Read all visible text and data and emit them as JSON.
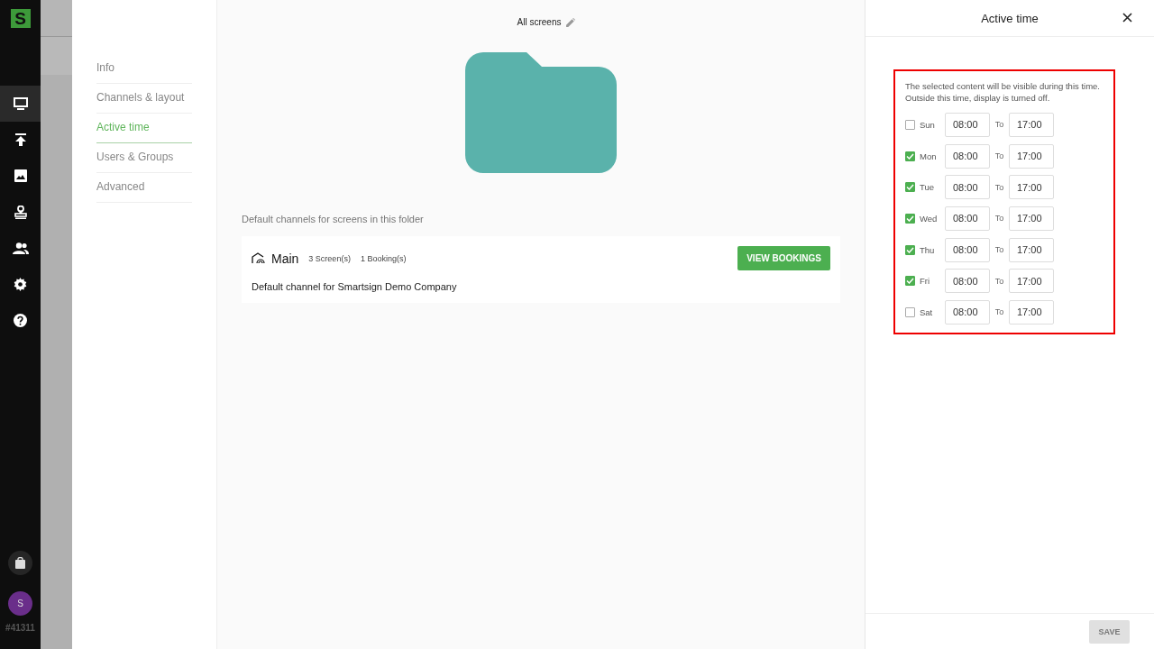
{
  "rail": {
    "logo": "S",
    "items": [
      {
        "kind": "monitor",
        "selected": true
      },
      {
        "kind": "upload",
        "selected": false
      },
      {
        "kind": "image",
        "selected": false
      },
      {
        "kind": "stamp",
        "selected": false
      },
      {
        "kind": "users",
        "selected": false
      },
      {
        "kind": "settings",
        "selected": false
      },
      {
        "kind": "help",
        "selected": false
      }
    ],
    "avatar": "S",
    "account_id": "#41311"
  },
  "nav": {
    "items": [
      {
        "label": "Info",
        "selected": false
      },
      {
        "label": "Channels & layout",
        "selected": false
      },
      {
        "label": "Active time",
        "selected": true
      },
      {
        "label": "Users & Groups",
        "selected": false
      },
      {
        "label": "Advanced",
        "selected": false
      }
    ]
  },
  "folder": {
    "name": "All screens",
    "channels_heading": "Default channels for screens in this folder",
    "channels": [
      {
        "name": "Main",
        "screens": "3 Screen(s)",
        "bookings": "1 Booking(s)",
        "description": "Default channel for Smartsign Demo Company",
        "button": "VIEW BOOKINGS"
      }
    ]
  },
  "panel": {
    "title": "Active time",
    "highlighted": true,
    "intro": "The selected content will be visible during this time. Outside this time, display is turned off.",
    "days": [
      {
        "day": "Sun",
        "checked": false,
        "from": "08:00",
        "to_label": "To",
        "to": "17:00"
      },
      {
        "day": "Mon",
        "checked": true,
        "from": "08:00",
        "to_label": "To",
        "to": "17:00"
      },
      {
        "day": "Tue",
        "checked": true,
        "from": "08:00",
        "to_label": "To",
        "to": "17:00"
      },
      {
        "day": "Wed",
        "checked": true,
        "from": "08:00",
        "to_label": "To",
        "to": "17:00"
      },
      {
        "day": "Thu",
        "checked": true,
        "from": "08:00",
        "to_label": "To",
        "to": "17:00"
      },
      {
        "day": "Fri",
        "checked": true,
        "from": "08:00",
        "to_label": "To",
        "to": "17:00"
      },
      {
        "day": "Sat",
        "checked": false,
        "from": "08:00",
        "to_label": "To",
        "to": "17:00"
      }
    ],
    "save": {
      "label": "SAVE",
      "disabled": true
    }
  }
}
